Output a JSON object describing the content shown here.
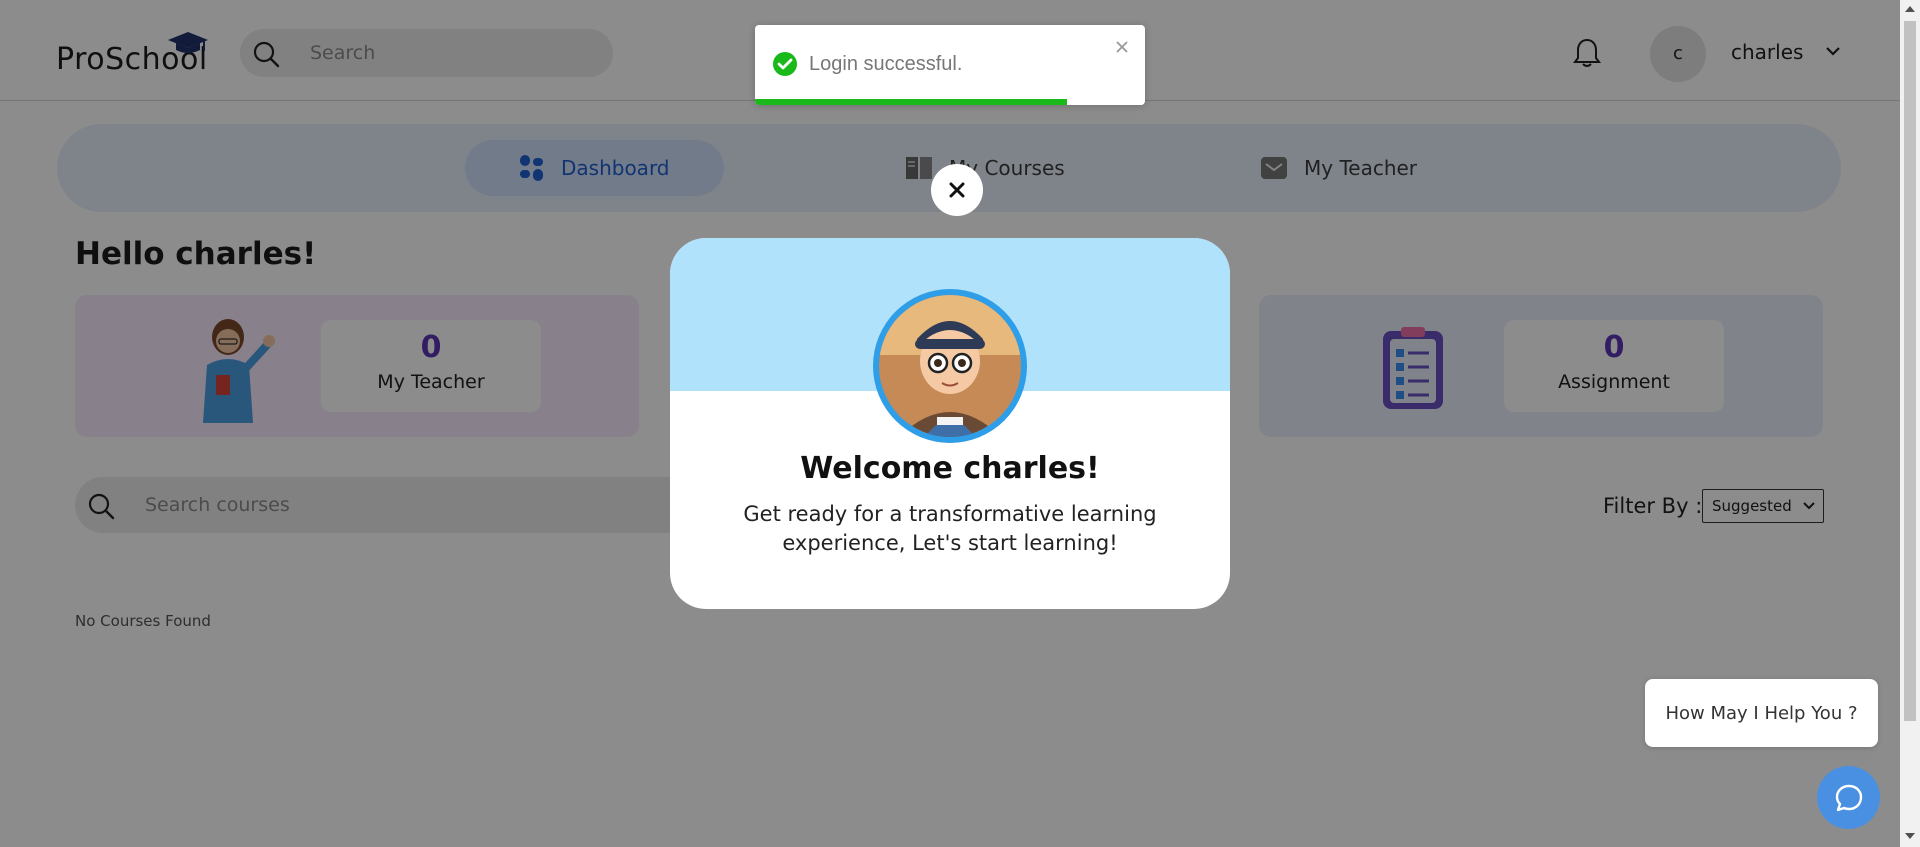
{
  "app": {
    "logo_text": "ProSchool"
  },
  "header": {
    "search_placeholder": "Search",
    "avatar_initial": "c",
    "user_name": "charles"
  },
  "nav": {
    "tabs": [
      {
        "label": "Dashboard",
        "active": true
      },
      {
        "label": "My Courses",
        "active": false
      },
      {
        "label": "My Teacher",
        "active": false
      }
    ]
  },
  "greeting": "Hello charles!",
  "stats": {
    "teacher": {
      "count": "0",
      "label": "My Teacher"
    },
    "assignment": {
      "count": "0",
      "label": "Assignment"
    }
  },
  "courses": {
    "search_placeholder": "Search courses",
    "filter_label": "Filter By :",
    "filter_value": "Suggested",
    "empty_message": "No Courses Found"
  },
  "welcome_modal": {
    "title": "Welcome charles!",
    "message": "Get ready for a transformative learning experience, Let's start learning!"
  },
  "toast": {
    "message": "Login successful.",
    "progress": 0.8,
    "status_color": "#18b918"
  },
  "chat": {
    "help_text": "How May I Help You ?"
  },
  "colors": {
    "accent": "#1f5fd1",
    "stat_number": "#5b35b6",
    "chat_button": "#4a90e2",
    "modal_band": "#b0e2fb"
  }
}
